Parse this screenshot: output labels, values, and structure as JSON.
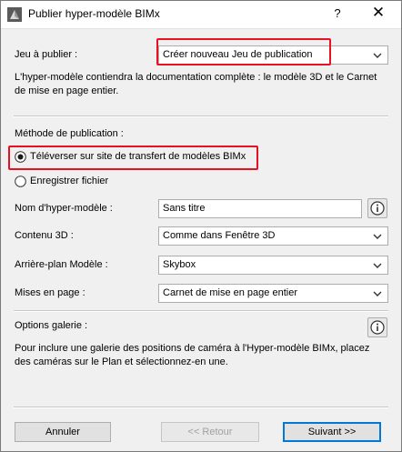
{
  "window": {
    "title": "Publier hyper-modèle BIMx",
    "help_label": "?",
    "close_label": "✕"
  },
  "publish_set": {
    "label": "Jeu à publier :",
    "value": "Créer nouveau Jeu de publication",
    "description": "L'hyper-modèle contiendra la documentation complète : le modèle 3D et le Carnet de mise en page entier."
  },
  "method": {
    "label": "Méthode de publication :",
    "options": [
      {
        "label": "Téléverser sur site de transfert de modèles BIMx",
        "selected": true
      },
      {
        "label": "Enregistrer fichier",
        "selected": false
      }
    ]
  },
  "fields": {
    "name_label": "Nom d'hyper-modèle :",
    "name_value": "Sans titre",
    "content3d_label": "Contenu 3D :",
    "content3d_value": "Comme dans Fenêtre 3D",
    "background_label": "Arrière-plan Modèle :",
    "background_value": "Skybox",
    "layouts_label": "Mises en page :",
    "layouts_value": "Carnet de mise en page entier"
  },
  "gallery": {
    "label": "Options galerie :",
    "description": "Pour inclure une galerie des positions de caméra à l'Hyper-modèle BIMx, placez des caméras sur le Plan et sélectionnez-en une."
  },
  "buttons": {
    "cancel": "Annuler",
    "back": "<< Retour",
    "next": "Suivant >>"
  },
  "colors": {
    "highlight": "#e81123",
    "accent": "#0078d7"
  }
}
